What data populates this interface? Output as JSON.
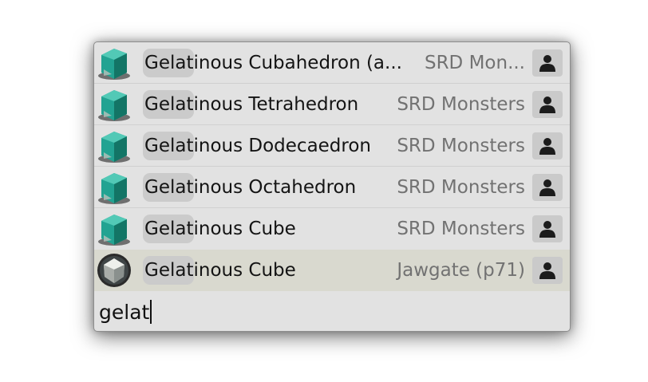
{
  "results": [
    {
      "name": "Gelatinous Cubahedron (a...",
      "source": "SRD Mon...",
      "icon": "gelatinous-cube-token-icon"
    },
    {
      "name": "Gelatinous Tetrahedron",
      "source": "SRD Monsters",
      "icon": "gelatinous-cube-token-icon"
    },
    {
      "name": "Gelatinous Dodecaedron",
      "source": "SRD Monsters",
      "icon": "gelatinous-cube-token-icon"
    },
    {
      "name": "Gelatinous Octahedron",
      "source": "SRD Monsters",
      "icon": "gelatinous-cube-token-icon"
    },
    {
      "name": "Gelatinous Cube",
      "source": "SRD Monsters",
      "icon": "gelatinous-cube-token-icon"
    },
    {
      "name": "Gelatinous Cube",
      "source": "Jawgate (p71)",
      "icon": "gem-token-icon",
      "selected": true
    }
  ],
  "search": {
    "value": "gelat"
  },
  "colors": {
    "selected_row": "#d9d9cf",
    "popup_bg": "#e2e2e2",
    "highlight": "#cbcbcb",
    "cube_teal": "#1f9b8a"
  }
}
